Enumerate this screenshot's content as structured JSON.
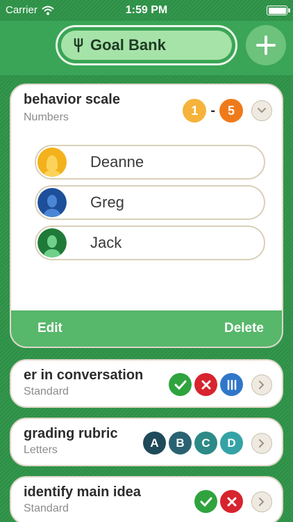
{
  "status_bar": {
    "carrier": "Carrier",
    "time": "1:59 PM",
    "wifi_icon": "wifi-icon",
    "battery_icon": "battery-icon"
  },
  "header": {
    "title": "Goal Bank",
    "title_icon": "fork-icon",
    "add_icon": "plus-icon"
  },
  "expanded_goal": {
    "title": "behavior scale",
    "subtitle": "Numbers",
    "scale_min": "1",
    "scale_dash": "-",
    "scale_max": "5",
    "collapse_icon": "chevron-down-icon",
    "students": [
      {
        "name": "Deanne",
        "avatar_color": "#f3b21c"
      },
      {
        "name": "Greg",
        "avatar_color": "#2b63b5"
      },
      {
        "name": "Jack",
        "avatar_color": "#2d9a4a"
      }
    ],
    "edit_label": "Edit",
    "delete_label": "Delete"
  },
  "goals": [
    {
      "title": "er in conversation",
      "subtitle": "Standard",
      "badges": [
        "check-icon",
        "x-icon",
        "tally-icon"
      ],
      "expand_icon": "chevron-right-icon"
    },
    {
      "title": "grading rubric",
      "subtitle": "Letters",
      "badges": [
        "A",
        "B",
        "C",
        "D"
      ],
      "expand_icon": "chevron-right-icon"
    },
    {
      "title": "identify main idea",
      "subtitle": "Standard",
      "badges": [
        "check-icon",
        "x-icon"
      ],
      "expand_icon": "chevron-right-icon"
    }
  ],
  "colors": {
    "background": "#2e9448",
    "header_bg": "#3aa556",
    "action_bar": "#57b76a",
    "scale_one": "#f5b33b",
    "scale_five": "#ef7a1a",
    "check": "#2fa33e",
    "cross": "#d7242f",
    "tally": "#2f77c9",
    "letter_a": "#1f4a5a",
    "letter_b": "#2a6272",
    "letter_c": "#2d8a86",
    "letter_d": "#35a3a6"
  }
}
